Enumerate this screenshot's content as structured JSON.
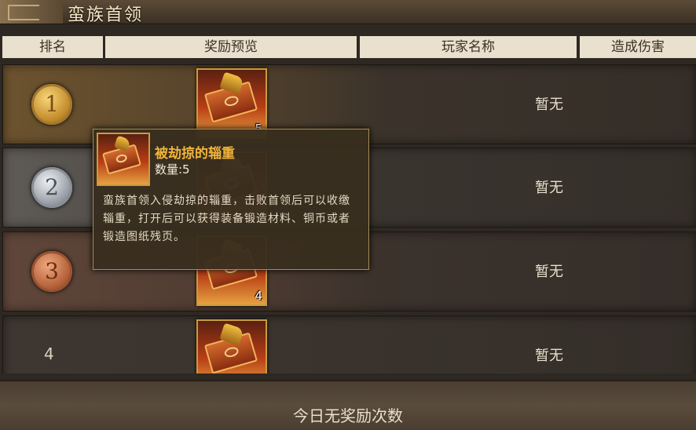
{
  "window": {
    "title": "蛮族首领"
  },
  "table": {
    "headers": {
      "rank": "排名",
      "reward": "奖励预览",
      "player": "玩家名称",
      "damage": "造成伤害"
    },
    "rows": [
      {
        "rank": "1",
        "medal": "gold",
        "reward_qty": "5",
        "player": "暂无"
      },
      {
        "rank": "2",
        "medal": "silver",
        "reward_qty": "",
        "player": "暂无"
      },
      {
        "rank": "3",
        "medal": "bronze",
        "reward_qty": "4",
        "player": "暂无"
      },
      {
        "rank": "4",
        "medal": "",
        "reward_qty": "",
        "player": "暂无"
      }
    ]
  },
  "tooltip": {
    "name": "被劫掠的辎重",
    "quantity": "数量:5",
    "description": "蛮族首领入侵劫掠的辎重，击败首领后可以收缴辎重，打开后可以获得装备锻造材料、铜币或者锻造图纸残页。"
  },
  "footer": {
    "text": "今日无奖励次数"
  },
  "colors": {
    "accent": "#f0b43a",
    "frame": "#c99b3e",
    "header_bg": "#e9e1cd"
  }
}
